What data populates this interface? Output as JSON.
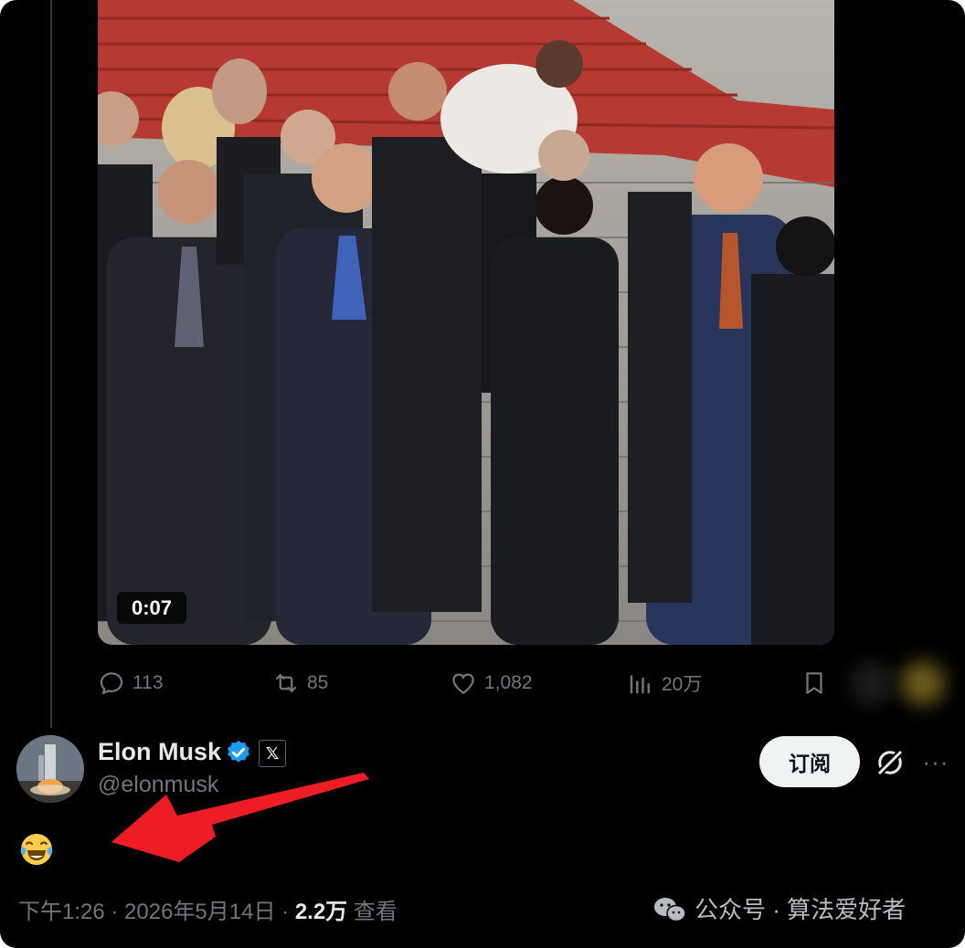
{
  "video": {
    "duration": "0:07"
  },
  "actions": {
    "replies": "113",
    "retweets": "85",
    "likes": "1,082",
    "views": "20万"
  },
  "author": {
    "name": "Elon Musk",
    "handle": "@elonmusk",
    "badge": "𝕏",
    "verified_color": "#1d9bf0"
  },
  "subscribe_label": "订阅",
  "tweet": {
    "text": "😂"
  },
  "meta": {
    "time": "下午1:26",
    "sep1": " · ",
    "date": "2026年5月14日",
    "sep2": " · ",
    "views_count": "2.2万",
    "views_label": " 查看"
  },
  "watermark": {
    "text": "公众号 · 算法爱好者"
  },
  "colors": {
    "background": "#000000",
    "muted": "#71767b",
    "text": "#e7e9ea",
    "arrow": "#ee1c24"
  }
}
